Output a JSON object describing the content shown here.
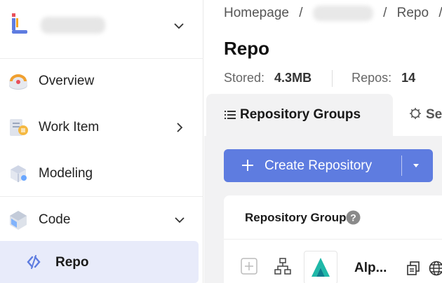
{
  "sidebar": {
    "project": {
      "name": "···"
    },
    "items": [
      {
        "label": "Overview"
      },
      {
        "label": "Work Item"
      },
      {
        "label": "Modeling"
      },
      {
        "label": "Code"
      },
      {
        "label": "Repo"
      }
    ]
  },
  "breadcrumb": {
    "home": "Homepage",
    "separator": "/",
    "project": "···",
    "current": "Repo"
  },
  "page": {
    "title": "Repo",
    "stats": {
      "stored_label": "Stored:",
      "stored_value": "4.3MB",
      "repos_label": "Repos:",
      "repos_value": "14"
    }
  },
  "tabs": [
    {
      "label": "Repository Groups",
      "icon": "list-icon",
      "active": true
    },
    {
      "label": "Se",
      "icon": "gear-icon",
      "active": false
    }
  ],
  "create_button": {
    "label": "Create Repository"
  },
  "card": {
    "title": "Repository Groups",
    "row": {
      "name": "Alp..."
    }
  },
  "colors": {
    "primary": "#5e7ce0",
    "active_nav_bg": "#e8ebfa",
    "content_bg": "#f2f2f3"
  }
}
